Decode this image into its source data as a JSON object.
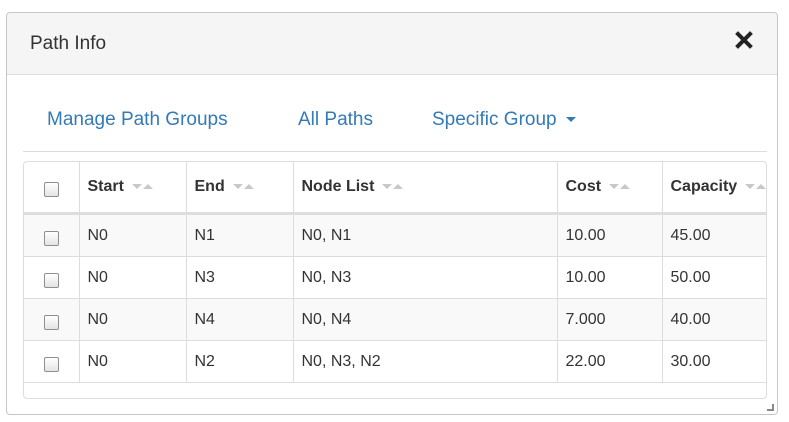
{
  "dialog": {
    "title": "Path Info",
    "close_icon": "close-icon"
  },
  "tabs": [
    {
      "label": "Manage Path Groups"
    },
    {
      "label": "All Paths"
    },
    {
      "label": "Specific Group",
      "has_caret": true
    }
  ],
  "table": {
    "columns": [
      "Start",
      "End",
      "Node List",
      "Cost",
      "Capacity"
    ],
    "rows": [
      {
        "start": "N0",
        "end": "N1",
        "nodes": "N0, N1",
        "cost": "10.00",
        "capacity": "45.00"
      },
      {
        "start": "N0",
        "end": "N3",
        "nodes": "N0, N3",
        "cost": "10.00",
        "capacity": "50.00"
      },
      {
        "start": "N0",
        "end": "N4",
        "nodes": "N0, N4",
        "cost": "7.000",
        "capacity": "40.00"
      },
      {
        "start": "N0",
        "end": "N2",
        "nodes": "N0, N3, N2",
        "cost": "22.00",
        "capacity": "30.00"
      }
    ]
  },
  "colors": {
    "link": "#337ab7",
    "header_bg": "#f5f5f5",
    "border": "#dddddd",
    "stripe": "#f9f9f9"
  }
}
